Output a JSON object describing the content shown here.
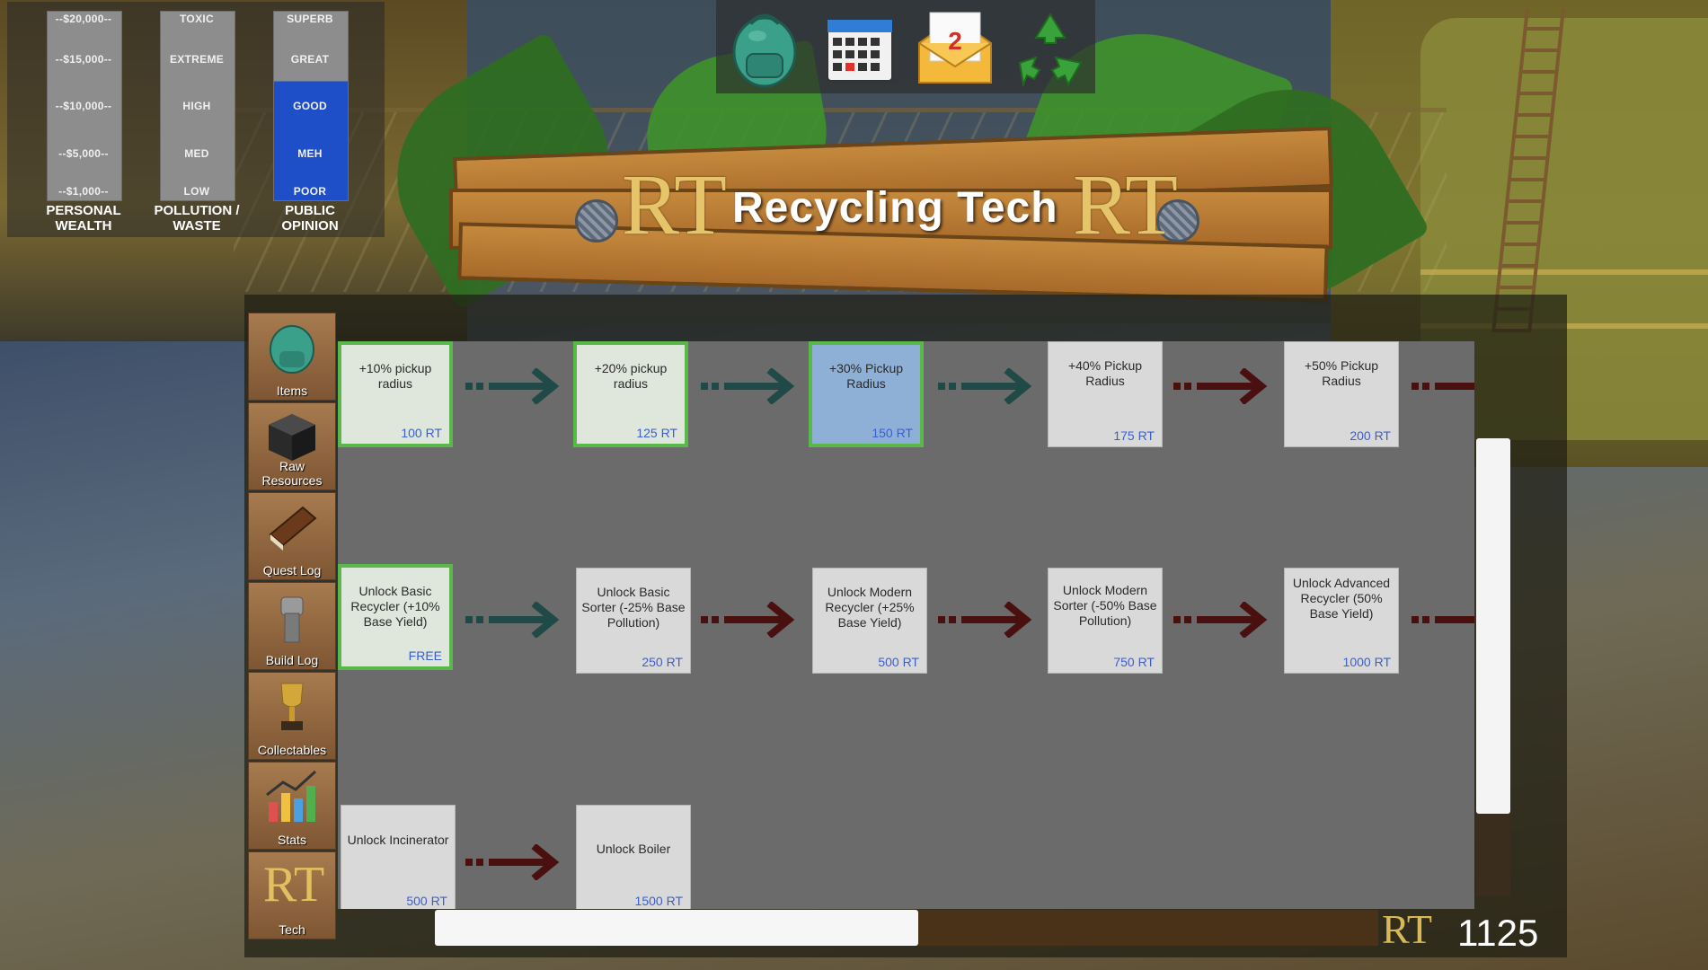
{
  "meters": {
    "wealth": {
      "levels": [
        "--$20,000--",
        "--$15,000--",
        "--$10,000--",
        "--$5,000--",
        "--$1,000--"
      ],
      "label_line1": "PERSONAL",
      "label_line2": "WEALTH"
    },
    "pollution": {
      "levels": [
        "TOXIC",
        "EXTREME",
        "HIGH",
        "MED",
        "LOW"
      ],
      "label_line1": "POLLUTION /",
      "label_line2": "WASTE"
    },
    "opinion": {
      "levels": [
        "SUPERB",
        "GREAT",
        "GOOD",
        "MEH",
        "POOR"
      ],
      "label_line1": "PUBLIC",
      "label_line2": "OPINION"
    }
  },
  "toolbar": {
    "icons": [
      "backpack-icon",
      "calendar-icon",
      "mail-icon",
      "recycle-icon"
    ],
    "mail_badge": "2"
  },
  "banner": {
    "title": "Recycling Tech",
    "logo": "RT"
  },
  "sidebar": {
    "items": [
      {
        "label": "Items",
        "icon": "backpack-icon"
      },
      {
        "label_line1": "Raw",
        "label_line2": "Resources",
        "icon": "cube-icon"
      },
      {
        "label": "Quest Log",
        "icon": "book-icon"
      },
      {
        "label": "Build Log",
        "icon": "fist-icon"
      },
      {
        "label": "Collectables",
        "icon": "trophy-icon"
      },
      {
        "label": "Stats",
        "icon": "chart-icon"
      },
      {
        "label": "Tech",
        "icon": "rt-logo-icon"
      }
    ]
  },
  "tech_tree": {
    "row1": [
      {
        "text": "+10% pickup radius",
        "cost": "100 RT",
        "state": "done"
      },
      {
        "text": "+20% pickup radius",
        "cost": "125 RT",
        "state": "done"
      },
      {
        "text": "+30% Pickup Radius",
        "cost": "150 RT",
        "state": "active"
      },
      {
        "text": "+40% Pickup Radius",
        "cost": "175 RT",
        "state": "locked"
      },
      {
        "text": "+50% Pickup Radius",
        "cost": "200 RT",
        "state": "locked"
      }
    ],
    "row2": [
      {
        "text": "Unlock Basic Recycler (+10% Base Yield)",
        "cost": "FREE",
        "state": "done"
      },
      {
        "text": "Unlock Basic Sorter (-25% Base Pollution)",
        "cost": "250 RT",
        "state": "locked"
      },
      {
        "text": "Unlock Modern Recycler (+25% Base Yield)",
        "cost": "500 RT",
        "state": "locked"
      },
      {
        "text": "Unlock Modern Sorter (-50% Base Pollution)",
        "cost": "750 RT",
        "state": "locked"
      },
      {
        "text": "Unlock Advanced Recycler (50% Base Yield)",
        "cost": "1000 RT",
        "state": "locked"
      }
    ],
    "row3": [
      {
        "text": "Unlock Incinerator",
        "cost": "500 RT",
        "state": "locked"
      },
      {
        "text": "Unlock Boiler",
        "cost": "1500 RT",
        "state": "locked"
      }
    ],
    "colors": {
      "unlocked_arrow": "#1f4a47",
      "locked_arrow": "#4a0f0f",
      "done_border": "#5ab84a",
      "active_fill": "#8fb0d6",
      "cost_text": "#3a5fd0"
    }
  },
  "currency": {
    "symbol": "RT",
    "balance": "1125"
  }
}
